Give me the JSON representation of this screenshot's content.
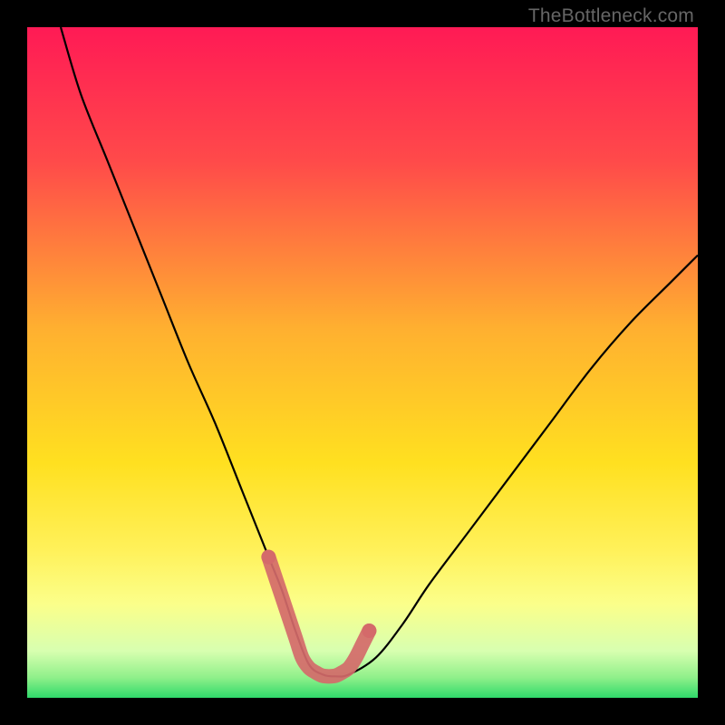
{
  "watermark": "TheBottleneck.com",
  "chart_data": {
    "type": "line",
    "title": "",
    "xlabel": "",
    "ylabel": "",
    "xlim": [
      0,
      100
    ],
    "ylim": [
      0,
      100
    ],
    "grid": false,
    "legend": false,
    "series": [
      {
        "name": "bottleneck-curve",
        "color": "#000000",
        "x": [
          5,
          8,
          12,
          16,
          20,
          24,
          28,
          32,
          34,
          36,
          38,
          40,
          42,
          44,
          46,
          48,
          52,
          56,
          60,
          66,
          72,
          78,
          84,
          90,
          96,
          100
        ],
        "y": [
          100,
          90,
          80,
          70,
          60,
          50,
          41,
          31,
          26,
          21,
          16,
          10,
          5,
          3.5,
          3.2,
          3.5,
          6,
          11,
          17,
          25,
          33,
          41,
          49,
          56,
          62,
          66
        ]
      },
      {
        "name": "optimal-zone-highlight",
        "color": "#d46a6a",
        "x": [
          36,
          38,
          40,
          41,
          42,
          43,
          44,
          45,
          46,
          47,
          48,
          49,
          50,
          51
        ],
        "y": [
          21,
          15,
          9,
          6,
          4.5,
          3.8,
          3.3,
          3.2,
          3.3,
          3.8,
          4.5,
          6,
          8,
          10
        ]
      }
    ],
    "green_band": {
      "y_top": 3.3,
      "y_bottom": 0,
      "color_top": "#aef27a",
      "color_bottom": "#2fd96a"
    },
    "yellow_band": {
      "y_top": 14,
      "y_bottom": 3.3,
      "color_top": "#fff15a",
      "color_bottom": "#f7ffb0"
    },
    "gradient_stops": [
      {
        "offset": 0,
        "color": "#ff1a55"
      },
      {
        "offset": 20,
        "color": "#ff4a4a"
      },
      {
        "offset": 45,
        "color": "#ffb030"
      },
      {
        "offset": 65,
        "color": "#ffe020"
      },
      {
        "offset": 78,
        "color": "#fff15a"
      },
      {
        "offset": 86,
        "color": "#fbff8a"
      },
      {
        "offset": 93,
        "color": "#d8ffb0"
      },
      {
        "offset": 97,
        "color": "#8ff08a"
      },
      {
        "offset": 100,
        "color": "#2fd96a"
      }
    ]
  }
}
